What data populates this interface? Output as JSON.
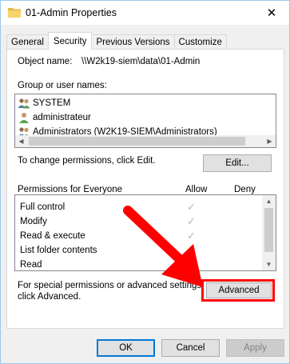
{
  "window": {
    "title": "01-Admin Properties",
    "close_glyph": "✕"
  },
  "tabs": [
    {
      "label": "General",
      "active": false
    },
    {
      "label": "Security",
      "active": true
    },
    {
      "label": "Previous Versions",
      "active": false
    },
    {
      "label": "Customize",
      "active": false
    }
  ],
  "object": {
    "label": "Object name:",
    "value": "\\\\W2k19-siem\\data\\01-Admin"
  },
  "groups": {
    "label": "Group or user names:",
    "items": [
      {
        "name": "SYSTEM",
        "icon": "users-group-icon"
      },
      {
        "name": "administrateur",
        "icon": "user-icon"
      },
      {
        "name": "Administrators (W2K19-SIEM\\Administrators)",
        "icon": "users-group-icon"
      }
    ]
  },
  "change": {
    "text": "To change permissions, click Edit.",
    "edit_label": "Edit..."
  },
  "permissions": {
    "header": "Permissions for Everyone",
    "allow": "Allow",
    "deny": "Deny",
    "rows": [
      {
        "name": "Full control",
        "allow": true
      },
      {
        "name": "Modify",
        "allow": true
      },
      {
        "name": "Read & execute",
        "allow": true
      },
      {
        "name": "List folder contents",
        "allow": true
      },
      {
        "name": "Read",
        "allow": true
      }
    ]
  },
  "advanced": {
    "text_line1": "For special permissions or advanced settings,",
    "text_line2": "click Advanced.",
    "button_label": "Advanced"
  },
  "footer": {
    "ok": "OK",
    "cancel": "Cancel",
    "apply": "Apply"
  },
  "colors": {
    "annotation_red": "#ff0000",
    "check_gray": "#b8b8b8",
    "focus_blue": "#0078d7"
  }
}
